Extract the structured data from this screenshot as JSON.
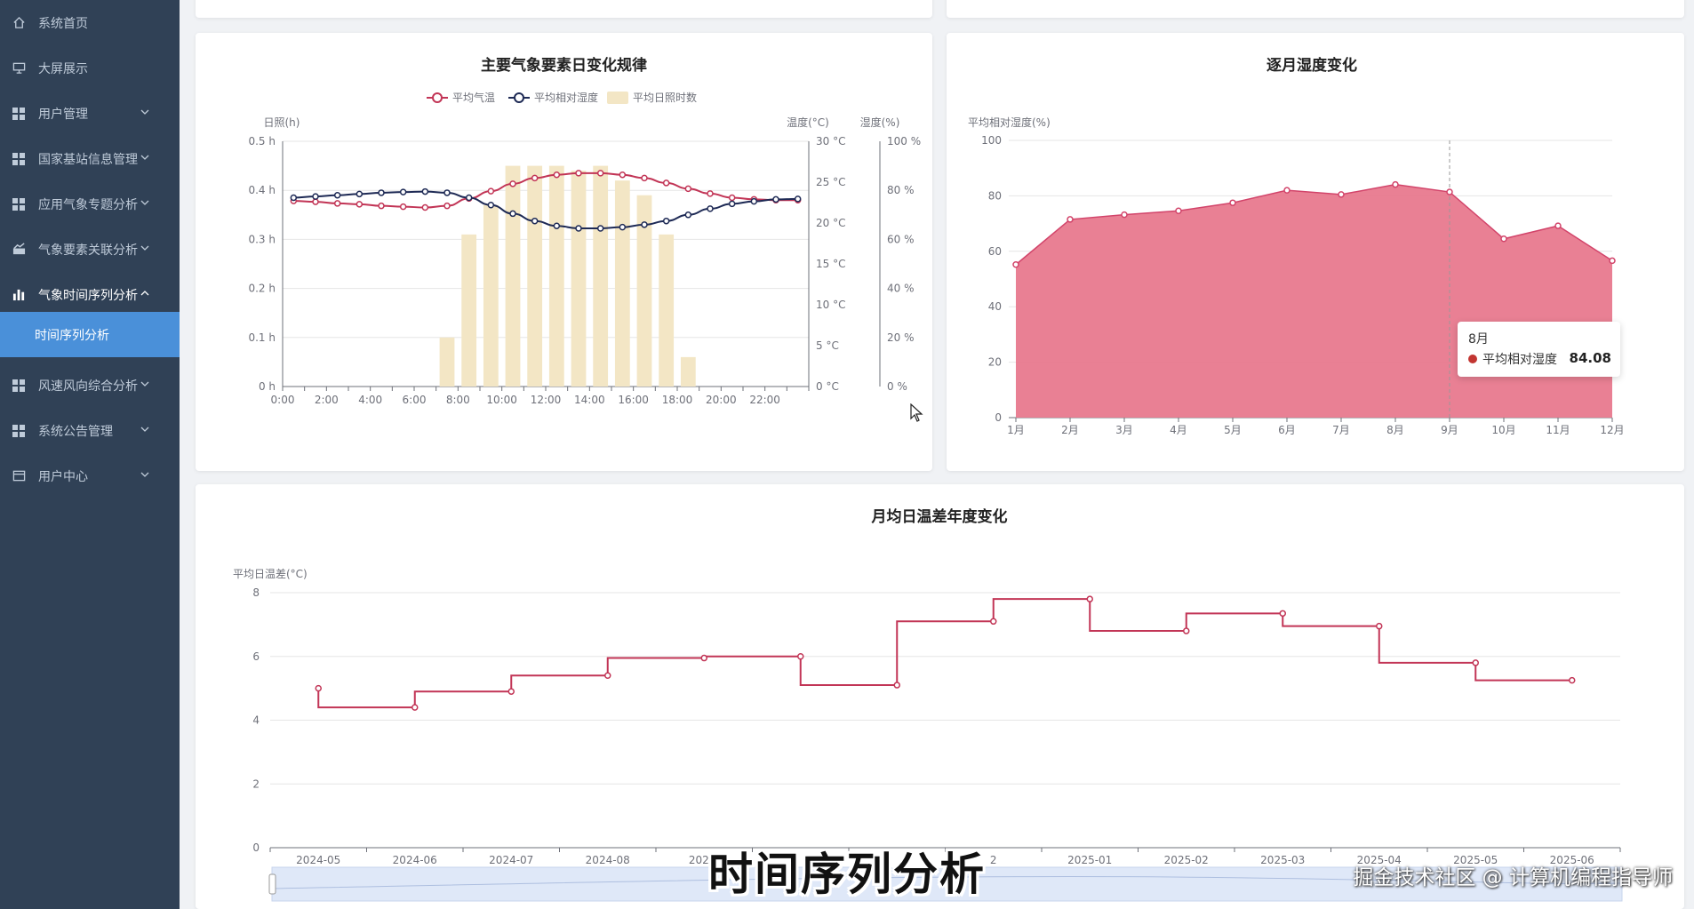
{
  "sidebar": {
    "items": [
      {
        "label": "系统首页",
        "icon": "home-icon",
        "arrow": false
      },
      {
        "label": "大屏展示",
        "icon": "monitor-icon",
        "arrow": false
      },
      {
        "label": "用户管理",
        "icon": "grid-icon",
        "arrow": true
      },
      {
        "label": "国家基站信息管理",
        "icon": "grid-icon",
        "arrow": true
      },
      {
        "label": "应用气象专题分析",
        "icon": "grid-icon",
        "arrow": true
      },
      {
        "label": "气象要素关联分析",
        "icon": "chart-icon",
        "arrow": true
      },
      {
        "label": "气象时间序列分析",
        "icon": "bar-chart-icon",
        "arrow": true,
        "expanded": true
      },
      {
        "label": "风速风向综合分析",
        "icon": "grid-icon",
        "arrow": true
      },
      {
        "label": "系统公告管理",
        "icon": "grid-icon",
        "arrow": true
      },
      {
        "label": "用户中心",
        "icon": "calendar-icon",
        "arrow": true
      }
    ],
    "active_sub": "时间序列分析"
  },
  "colors": {
    "sidebar_bg": "#304156",
    "active_bg": "#4a90d9",
    "temp": "#c23556",
    "humidity": "#1e2a55",
    "sunshine": "#f3e6c5",
    "area": "#e8798e"
  },
  "tooltip": {
    "title": "8月",
    "label": "平均相对湿度",
    "value": "84.08"
  },
  "subtitle": "时间序列分析",
  "watermark": "掘金技术社区 @ 计算机编程指导师",
  "chart_data": [
    {
      "type": "line",
      "title": "主要气象要素日变化规律",
      "legend": [
        "平均气温",
        "平均相对湿度",
        "平均日照时数"
      ],
      "axis_names": {
        "left": "日照(h)",
        "right1": "温度(°C)",
        "right2": "湿度(%)"
      },
      "x": [
        "0:00",
        "1:00",
        "2:00",
        "3:00",
        "4:00",
        "5:00",
        "6:00",
        "7:00",
        "8:00",
        "9:00",
        "10:00",
        "11:00",
        "12:00",
        "13:00",
        "14:00",
        "15:00",
        "16:00",
        "17:00",
        "18:00",
        "19:00",
        "20:00",
        "21:00",
        "22:00",
        "23:00"
      ],
      "x_ticks": [
        "0:00",
        "2:00",
        "4:00",
        "6:00",
        "8:00",
        "10:00",
        "12:00",
        "14:00",
        "16:00",
        "18:00",
        "20:00",
        "22:00"
      ],
      "y_left_ticks": [
        "0 h",
        "0.1 h",
        "0.2 h",
        "0.3 h",
        "0.4 h",
        "0.5 h"
      ],
      "y_right1_ticks": [
        "0 °C",
        "5 °C",
        "10 °C",
        "15 °C",
        "20 °C",
        "25 °C",
        "30 °C"
      ],
      "y_right2_ticks": [
        "0 %",
        "20 %",
        "40 %",
        "60 %",
        "80 %",
        "100 %"
      ],
      "ylim_left": [
        0,
        0.5
      ],
      "ylim_temp": [
        0,
        30
      ],
      "ylim_hum": [
        0,
        100
      ],
      "series": [
        {
          "name": "平均日照时数",
          "type": "bar",
          "axis": "left",
          "values": [
            0,
            0,
            0,
            0,
            0,
            0,
            0,
            0.1,
            0.31,
            0.37,
            0.45,
            0.45,
            0.45,
            0.44,
            0.45,
            0.42,
            0.39,
            0.31,
            0.06,
            0,
            0,
            0,
            0,
            0
          ]
        },
        {
          "name": "平均气温",
          "type": "line",
          "axis": "temp",
          "values": [
            22.7,
            22.6,
            22.4,
            22.3,
            22.1,
            22.0,
            21.9,
            22.1,
            23.0,
            23.9,
            24.8,
            25.5,
            25.9,
            26.1,
            26.1,
            25.9,
            25.5,
            24.9,
            24.2,
            23.6,
            23.1,
            22.9,
            22.8,
            22.8
          ]
        },
        {
          "name": "平均相对湿度",
          "type": "line",
          "axis": "hum",
          "values": [
            77,
            77.5,
            78,
            78.5,
            79,
            79.3,
            79.5,
            79,
            77,
            74,
            70.5,
            67.5,
            65.5,
            64.5,
            64.5,
            65,
            66,
            67.5,
            70,
            72.5,
            74.5,
            75.5,
            76.3,
            76.5
          ]
        }
      ]
    },
    {
      "type": "area",
      "title": "逐月湿度变化",
      "ylabel": "平均相对湿度(%)",
      "categories": [
        "1月",
        "2月",
        "3月",
        "4月",
        "5月",
        "6月",
        "7月",
        "8月",
        "9月",
        "10月",
        "11月",
        "12月"
      ],
      "values": [
        55.2,
        71.5,
        73.2,
        74.6,
        77.5,
        82.0,
        80.5,
        84.08,
        81.4,
        64.5,
        69.2,
        56.6
      ],
      "ylim": [
        0,
        100
      ],
      "y_ticks": [
        "0",
        "20",
        "40",
        "60",
        "80",
        "100"
      ]
    },
    {
      "type": "line",
      "title": "月均日温差年度变化",
      "ylabel": "平均日温差(°C)",
      "step": "end",
      "categories": [
        "2024-05",
        "2024-06",
        "2024-07",
        "2024-08",
        "2024-09",
        "2024-10",
        "2024-11",
        "2024-12",
        "2025-01",
        "2025-02",
        "2025-03",
        "2025-04",
        "2025-05",
        "2025-06"
      ],
      "x_tick_labels": [
        "2024-05",
        "2024-06",
        "2024-07",
        "2024-08",
        "2024-",
        "",
        "",
        "2",
        "2025-01",
        "2025-02",
        "2025-03",
        "2025-04",
        "2025-05",
        "2025-06"
      ],
      "values": [
        5.0,
        4.4,
        4.9,
        5.4,
        5.95,
        6.0,
        5.1,
        7.1,
        7.8,
        6.8,
        7.35,
        6.95,
        5.8,
        5.25
      ],
      "ylim": [
        0,
        8
      ],
      "y_ticks": [
        "0",
        "2",
        "4",
        "6",
        "8"
      ]
    }
  ]
}
